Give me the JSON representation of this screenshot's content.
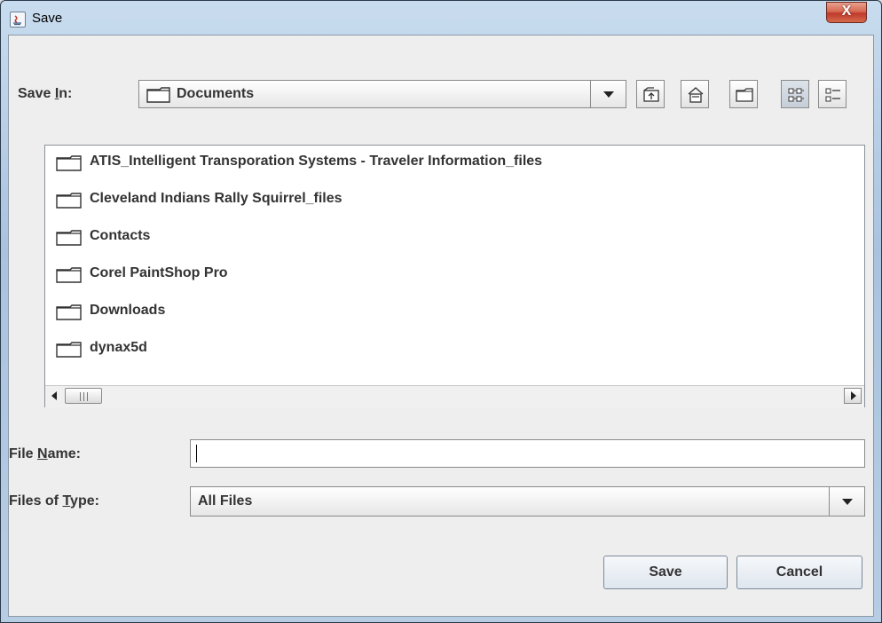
{
  "window": {
    "title": "Save",
    "close_label": "X"
  },
  "save_in": {
    "label_pre": "Save ",
    "label_mnemonic": "I",
    "label_post": "n:",
    "value": "Documents"
  },
  "toolbar": {
    "icons": [
      "up-one-level-icon",
      "home-icon",
      "new-folder-icon",
      "list-view-icon",
      "details-view-icon"
    ]
  },
  "files": [
    "ATIS_Intelligent Transporation Systems - Traveler Information_files",
    "Cleveland Indians Rally Squirrel_files",
    "Contacts",
    "Corel PaintShop Pro",
    "Downloads",
    "dynax5d"
  ],
  "file_name": {
    "label_pre": "File ",
    "label_mnemonic": "N",
    "label_post": "ame:",
    "value": ""
  },
  "files_of_type": {
    "label_pre": "Files of ",
    "label_mnemonic": "T",
    "label_post": "ype:",
    "value": "All Files"
  },
  "buttons": {
    "save": "Save",
    "cancel": "Cancel"
  },
  "colors": {
    "window_frame": "#a9c3df",
    "close_button": "#c0392b",
    "dialog_bg": "#eeeeee"
  }
}
